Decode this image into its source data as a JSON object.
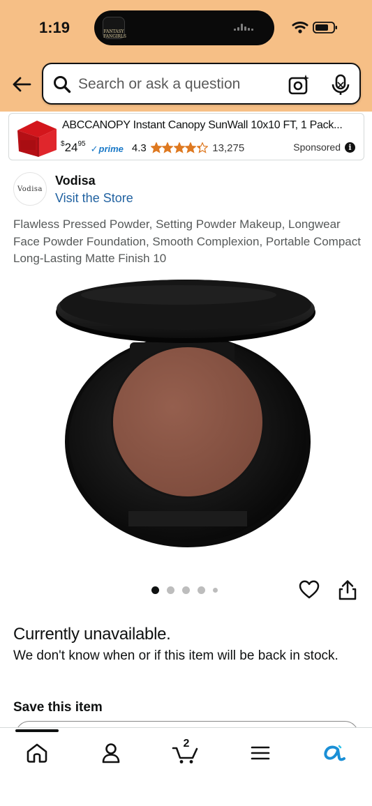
{
  "status_bar": {
    "time": "1:19",
    "island_app_label": "FANTASY FANGIRLS"
  },
  "header": {
    "search_placeholder": "Search or ask a question",
    "icons": [
      "back-arrow-icon",
      "search-icon",
      "camera-lens-icon",
      "microphone-icon"
    ]
  },
  "ad": {
    "title": "ABCCANOPY Instant Canopy SunWall 10x10 FT, 1 Pack...",
    "price_symbol": "$",
    "price_whole": "24",
    "price_fraction": "95",
    "prime_check": "✓",
    "prime_label": "prime",
    "rating": "4.3",
    "rating_value": 4.3,
    "review_count": "13,275",
    "sponsored_label": "Sponsored",
    "info_glyph": "i"
  },
  "brand": {
    "logo_text": "Vodisa",
    "name": "Vodisa",
    "visit_store": "Visit the Store"
  },
  "product": {
    "title": "Flawless Pressed Powder, Setting Powder Makeup, Longwear Face Powder Foundation, Smooth Complexion, Portable Compact Long-Lasting Matte Finish 10",
    "image_count": 5,
    "active_image": 1,
    "powder_color": "#8a5646"
  },
  "availability": {
    "title": "Currently unavailable.",
    "message": "We don't know when or if this item will be back in stock."
  },
  "save": {
    "title": "Save this item"
  },
  "bottom_nav": {
    "items": [
      "home-icon",
      "account-icon",
      "cart-icon",
      "menu-icon",
      "rufus-icon"
    ],
    "cart_count": "2"
  },
  "colors": {
    "header_bg": "#f6bf86",
    "link": "#2162a1",
    "star": "#de7921",
    "prime": "#1a79c7",
    "accent_blue": "#1a8fd6"
  }
}
